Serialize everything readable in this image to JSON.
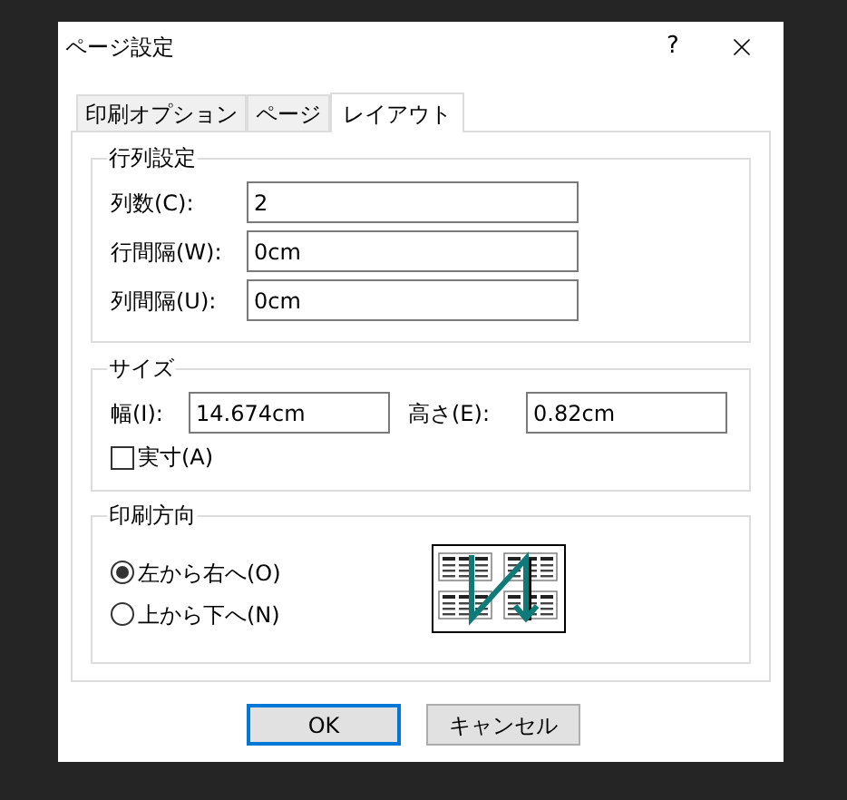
{
  "window": {
    "title": "ページ設定",
    "help": "?"
  },
  "tabs": [
    {
      "label": "印刷オプション",
      "selected": false
    },
    {
      "label": "ページ",
      "selected": false
    },
    {
      "label": "レイアウト",
      "selected": true
    }
  ],
  "grid_settings": {
    "title": "行列設定",
    "fields": [
      {
        "label": "列数(C):",
        "value": "2"
      },
      {
        "label": "行間隔(W):",
        "value": "0cm"
      },
      {
        "label": "列間隔(U):",
        "value": "0cm"
      }
    ]
  },
  "size": {
    "title": "サイズ",
    "fields": [
      {
        "label": "幅(I):",
        "value": "14.674cm"
      },
      {
        "label": "高さ(E):",
        "value": "0.82cm"
      }
    ],
    "actual_size": {
      "label": "実寸(A)",
      "checked": false
    }
  },
  "print_order": {
    "title": "印刷方向",
    "options": [
      {
        "label": "左から右へ(O)",
        "selected": true
      },
      {
        "label": "上から下へ(N)",
        "selected": false
      }
    ]
  },
  "buttons": [
    {
      "label": "OK",
      "default": true
    },
    {
      "label": "キャンセル",
      "default": false
    }
  ]
}
